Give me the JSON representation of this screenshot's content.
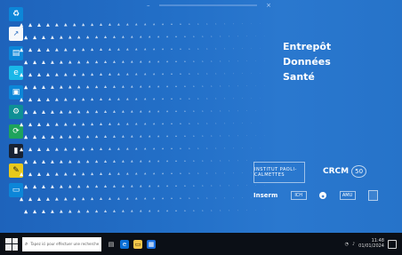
{
  "window": {
    "title": "Entrepôt Données Santé"
  },
  "desktop": {
    "icons": [
      {
        "name": "recycle-bin-icon",
        "glyph": "♻"
      },
      {
        "name": "shortcut-icon",
        "glyph": "↗"
      },
      {
        "name": "document-icon",
        "glyph": "▤"
      },
      {
        "name": "browser-icon",
        "glyph": "e"
      },
      {
        "name": "app-icon",
        "glyph": "▣"
      },
      {
        "name": "tool-icon",
        "glyph": "⚙"
      },
      {
        "name": "refresh-icon",
        "glyph": "⟳"
      },
      {
        "name": "terminal-icon",
        "glyph": "▮"
      },
      {
        "name": "notes-icon",
        "glyph": "✎"
      },
      {
        "name": "folder-icon",
        "glyph": "▭"
      }
    ],
    "title_lines": [
      "Entrepôt",
      "Données",
      "Santé"
    ],
    "logos": {
      "top_left": "INSTITUT PAOLI-CALMETTES",
      "top_right_name": "CRCM",
      "top_right_num": "50",
      "bottom_left": "Inserm",
      "bottom_chip_1": "ICH",
      "bottom_circle": "◉",
      "bottom_chip_2": "AMU",
      "bottom_shield": ""
    }
  },
  "taskbar": {
    "search_placeholder": "Tapez ici pour effectuer une recherche",
    "time": "11:48",
    "date": "01/01/2024"
  },
  "colors": {
    "desktop_blue": "#1f67bf",
    "taskbar": "#0b0f16",
    "white": "#ffffff"
  }
}
